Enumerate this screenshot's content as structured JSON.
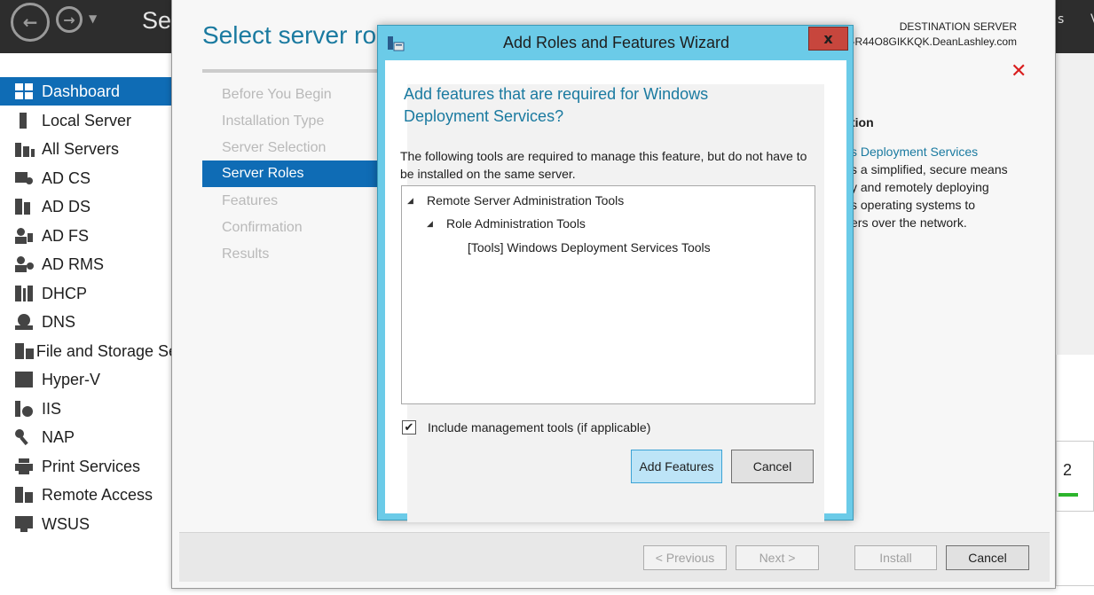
{
  "server_manager": {
    "title": "Ser",
    "right_partial_1": "s",
    "right_partial_2": "V",
    "sidebar": [
      {
        "label": "Dashboard",
        "icon": "dashboard-icon",
        "active": true
      },
      {
        "label": "Local Server",
        "icon": "server-icon"
      },
      {
        "label": "All Servers",
        "icon": "servers-icon"
      },
      {
        "label": "AD CS",
        "icon": "certificate-icon"
      },
      {
        "label": "AD DS",
        "icon": "directory-icon"
      },
      {
        "label": "AD FS",
        "icon": "federation-icon"
      },
      {
        "label": "AD RMS",
        "icon": "rights-management-icon"
      },
      {
        "label": "DHCP",
        "icon": "dhcp-icon"
      },
      {
        "label": "DNS",
        "icon": "dns-icon"
      },
      {
        "label": "File and Storage Se",
        "icon": "storage-icon"
      },
      {
        "label": "Hyper-V",
        "icon": "hyperv-icon"
      },
      {
        "label": "IIS",
        "icon": "iis-icon"
      },
      {
        "label": "NAP",
        "icon": "nap-icon"
      },
      {
        "label": "Print Services",
        "icon": "printer-icon"
      },
      {
        "label": "Remote Access",
        "icon": "remote-access-icon"
      },
      {
        "label": "WSUS",
        "icon": "wsus-icon"
      }
    ],
    "right_card_number": "2"
  },
  "wizard": {
    "heading": "Select server rol",
    "destination_label": "DESTINATION SERVER",
    "destination_name": "-R44O8GIKKQK.DeanLashley.com",
    "steps": [
      {
        "label": "Before You Begin",
        "active": false
      },
      {
        "label": "Installation Type",
        "active": false
      },
      {
        "label": "Server Selection",
        "active": false
      },
      {
        "label": "Server Roles",
        "active": true
      },
      {
        "label": "Features",
        "active": false
      },
      {
        "label": "Confirmation",
        "active": false
      },
      {
        "label": "Results",
        "active": false
      }
    ],
    "description": {
      "heading": "tion",
      "link": "s Deployment Services",
      "lines": [
        "s a simplified, secure means",
        "y and remotely deploying",
        "s operating systems to",
        "ers over the network."
      ]
    },
    "buttons": {
      "previous": "< Previous",
      "next": "Next >",
      "install": "Install",
      "cancel": "Cancel"
    }
  },
  "dialog": {
    "title": "Add Roles and Features Wizard",
    "close_label": "x",
    "heading": "Add features that are required for Windows Deployment Services?",
    "description": "The following tools are required to manage this feature, but do not have to be installed on the same server.",
    "tree": [
      {
        "label": "Remote Server Administration Tools",
        "level": 0,
        "expanded": true
      },
      {
        "label": "Role Administration Tools",
        "level": 1,
        "expanded": true
      },
      {
        "label": "[Tools] Windows Deployment Services Tools",
        "level": 2,
        "expanded": false
      }
    ],
    "checkbox_label": "Include management tools (if applicable)",
    "checkbox_checked": true,
    "add_button": "Add Features",
    "cancel_button": "Cancel"
  },
  "colors": {
    "accent_blue": "#0f6cb5",
    "heading_teal": "#1a7aa0",
    "dialog_frame": "#6bcbe8",
    "close_red": "#c7463d",
    "error_x": "#d91e1e"
  }
}
